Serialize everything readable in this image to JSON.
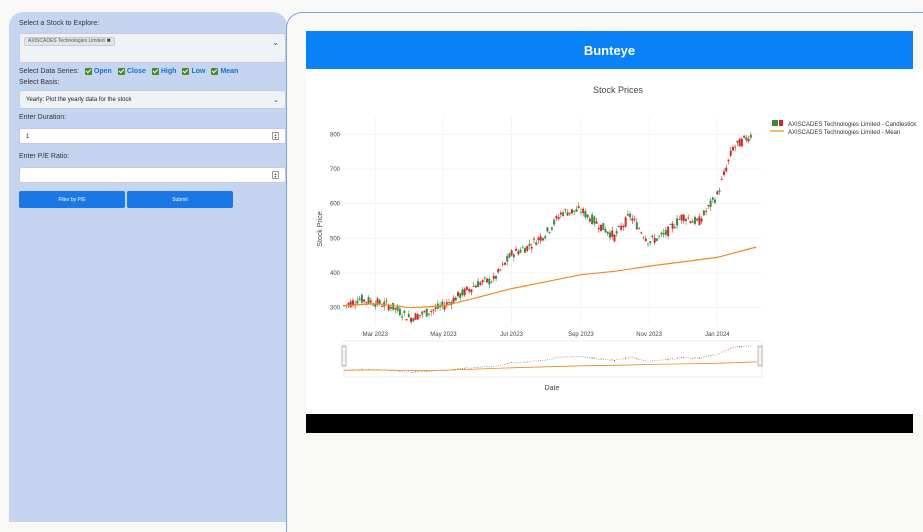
{
  "sidebar": {
    "stock_label": "Select a Stock to Explore:",
    "stock_tag": "AXISCADES Technologies Limited",
    "series_label": "Select Data Series:",
    "series": [
      "Open",
      "Close",
      "High",
      "Low",
      "Mean"
    ],
    "basis_label": "Select Basis:",
    "basis_value": "Yearly: Plot the yearly data for the stock",
    "duration_label": "Enter Duration:",
    "duration_value": "1",
    "pe_label": "Enter P/E Ratio:",
    "pe_value": "",
    "filter_button": "Filter by P/E",
    "submit_button": "Submit"
  },
  "banner": {
    "title": "Bunteye"
  },
  "colors": {
    "increasing": "#3a8a3a",
    "decreasing": "#d62728",
    "mean": "#f28a1e",
    "banner": "#0a82f7",
    "sidebar": "#c5d5ef"
  },
  "chart_data": {
    "type": "line",
    "title": "Stock Prices",
    "xlabel": "Date",
    "ylabel": "Stock Price",
    "x_ticks": [
      "Mar 2023",
      "May 2023",
      "Jul 2023",
      "Sep 2023",
      "Nov 2023",
      "Jan 2024"
    ],
    "y_ticks": [
      300,
      400,
      500,
      600,
      700,
      800
    ],
    "ylim": [
      250,
      850
    ],
    "xlim": [
      "2023-02-01",
      "2024-02-10"
    ],
    "grid": true,
    "legend_position": "top-right",
    "series": [
      {
        "name": "AXISCADES Technologies Limited - Candlestick",
        "kind": "candlestick",
        "x": [
          "2023-02-01",
          "2023-02-15",
          "2023-03-01",
          "2023-03-15",
          "2023-04-01",
          "2023-04-15",
          "2023-05-01",
          "2023-05-15",
          "2023-06-01",
          "2023-06-15",
          "2023-07-01",
          "2023-07-15",
          "2023-08-01",
          "2023-08-15",
          "2023-09-01",
          "2023-09-15",
          "2023-10-01",
          "2023-10-15",
          "2023-11-01",
          "2023-11-15",
          "2023-12-01",
          "2023-12-15",
          "2024-01-01",
          "2024-01-15",
          "2024-02-01"
        ],
        "values": [
          305,
          325,
          315,
          305,
          270,
          285,
          305,
          335,
          370,
          380,
          455,
          475,
          515,
          575,
          580,
          545,
          505,
          565,
          490,
          510,
          565,
          545,
          625,
          760,
          800
        ]
      },
      {
        "name": "AXISCADES Technologies Limited - Mean",
        "kind": "line",
        "x": [
          "2023-02-01",
          "2023-03-01",
          "2023-04-01",
          "2023-05-01",
          "2023-06-01",
          "2023-07-01",
          "2023-08-01",
          "2023-09-01",
          "2023-10-01",
          "2023-11-01",
          "2023-12-01",
          "2024-01-01",
          "2024-02-05"
        ],
        "values": [
          305,
          312,
          300,
          305,
          330,
          355,
          375,
          395,
          405,
          420,
          432,
          445,
          475
        ]
      }
    ]
  }
}
